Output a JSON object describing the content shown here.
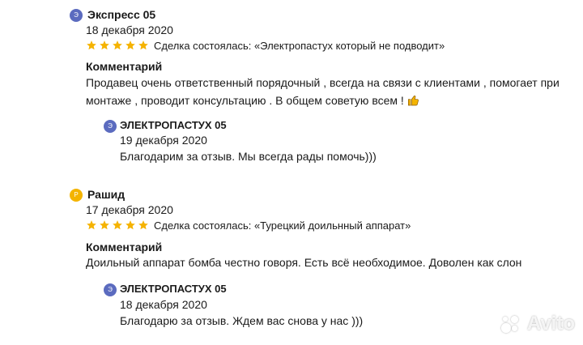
{
  "reviews": [
    {
      "avatar_letter": "Э",
      "avatar_color": "#5b6bbf",
      "author": "Экспресс 05",
      "date": "18 декабря 2020",
      "rating": 5,
      "deal": "Сделка состоялась: «Электропастух который не подводит»",
      "comment_title": "Комментарий",
      "comment_line1": "Продавец очень ответственный порядочный , всегда на связи с клиентами , помогает при",
      "comment_line2": "монтаже , проводит консультацию . В общем советую всем !",
      "reply": {
        "avatar_letter": "Э",
        "avatar_color": "#5b6bbf",
        "author": "ЭЛЕКТРОПАСТУХ 05",
        "date": "19 декабря 2020",
        "text": "Благодарим за отзыв. Мы всегда рады помочь)))"
      }
    },
    {
      "avatar_letter": "Р",
      "avatar_color": "#f4b400",
      "author": "Рашид",
      "date": "17 декабря 2020",
      "rating": 5,
      "deal": "Сделка состоялась: «Турецкий доильнный аппарат»",
      "comment_title": "Комментарий",
      "comment_line1": "Доильный аппарат бомба честно говоря. Есть всё необходимое. Доволен как слон",
      "reply": {
        "avatar_letter": "Э",
        "avatar_color": "#5b6bbf",
        "author": "ЭЛЕКТРОПАСТУХ 05",
        "date": "18 декабря 2020",
        "text": "Благодарю за отзыв. Ждем вас снова у нас )))"
      }
    }
  ],
  "star_color": "#f5b301",
  "watermark": "Avito"
}
